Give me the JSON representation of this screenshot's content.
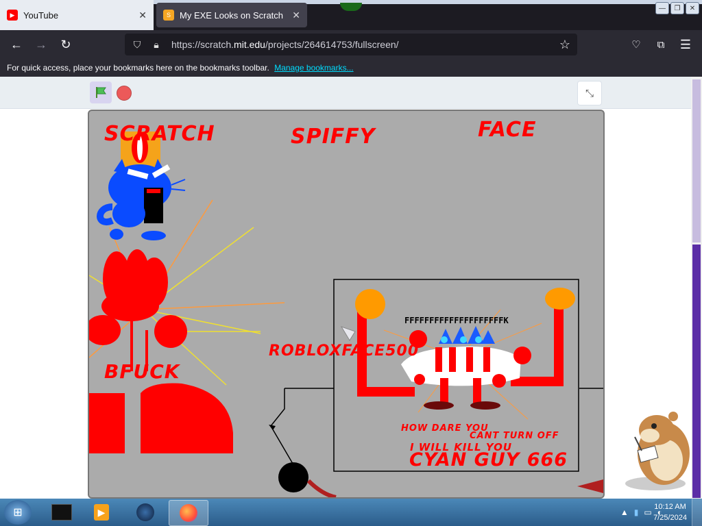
{
  "browser": {
    "tabs": [
      {
        "label": "YouTube",
        "icon": "youtube-icon"
      },
      {
        "label": "My EXE Looks on Scratch",
        "icon": "scratch-icon"
      }
    ],
    "url_prefix": "https://scratch.",
    "url_host": "mit.edu",
    "url_suffix": "/projects/264614753/fullscreen/",
    "bookmarks_message": "For quick access, place your bookmarks here on the bookmarks toolbar.",
    "manage_bookmarks": "Manage bookmarks..."
  },
  "stage_text": {
    "label_scratch": "SCRATCH",
    "label_spiffy": "SPIFFY",
    "label_face": "FACE",
    "label_bfuck": "BFUCK",
    "label_roblox": "ROBLOXFACE500",
    "line_how_dare": "HOW DARE YOU",
    "line_cant_turn": "CANT TURN OFF",
    "line_kill": "I WILL KILL YOU",
    "line_cyan": "CYAN GUY 666"
  },
  "taskbar": {
    "time": "10:12 AM",
    "date": "7/25/2024"
  },
  "colors": {
    "stage_bg": "#ababab",
    "accent_red": "#ff0000",
    "scratch_purple": "#5b2ea6"
  }
}
